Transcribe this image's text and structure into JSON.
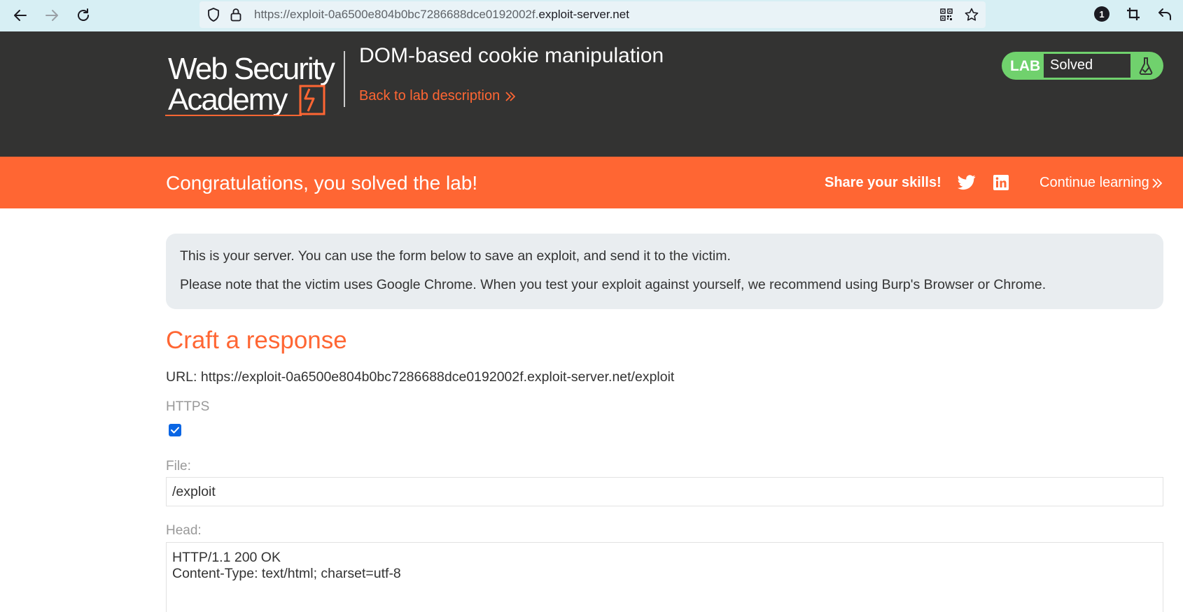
{
  "browser": {
    "url_prefix": "https://exploit-0a6500e804b0bc7286688dce0192002f.",
    "url_domain": "exploit-server.net",
    "extension_badge": "1",
    "icons": [
      "back-arrow-icon",
      "forward-arrow-icon",
      "reload-icon",
      "shield-icon",
      "lock-icon",
      "qr-code-icon",
      "star-icon",
      "extension-badge-icon",
      "crop-icon",
      "undo-arrow-icon"
    ]
  },
  "header": {
    "logo_line1": "Web Security",
    "logo_line2": "Academy",
    "title": "DOM-based cookie manipulation",
    "back_link": "Back to lab description",
    "lab_label": "LAB",
    "lab_status": "Solved"
  },
  "notification": {
    "message": "Congratulations, you solved the lab!",
    "share_label": "Share your skills!",
    "continue_label": "Continue learning"
  },
  "info": {
    "line1": "This is your server. You can use the form below to save an exploit, and send it to the victim.",
    "line2": "Please note that the victim uses Google Chrome. When you test your exploit against yourself, we recommend using Burp's Browser or Chrome."
  },
  "form": {
    "title": "Craft a response",
    "url_line": "URL: https://exploit-0a6500e804b0bc7286688dce0192002f.exploit-server.net/exploit",
    "https_label": "HTTPS",
    "https_checked": true,
    "file_label": "File:",
    "file_value": "/exploit",
    "head_label": "Head:",
    "head_value": "HTTP/1.1 200 OK\nContent-Type: text/html; charset=utf-8"
  },
  "colors": {
    "brand_orange": "#ff6633",
    "header_bg": "#333332",
    "solved_green": "#70d16d",
    "browser_bar": "#d7eff4",
    "info_bg": "#e9edf0"
  }
}
